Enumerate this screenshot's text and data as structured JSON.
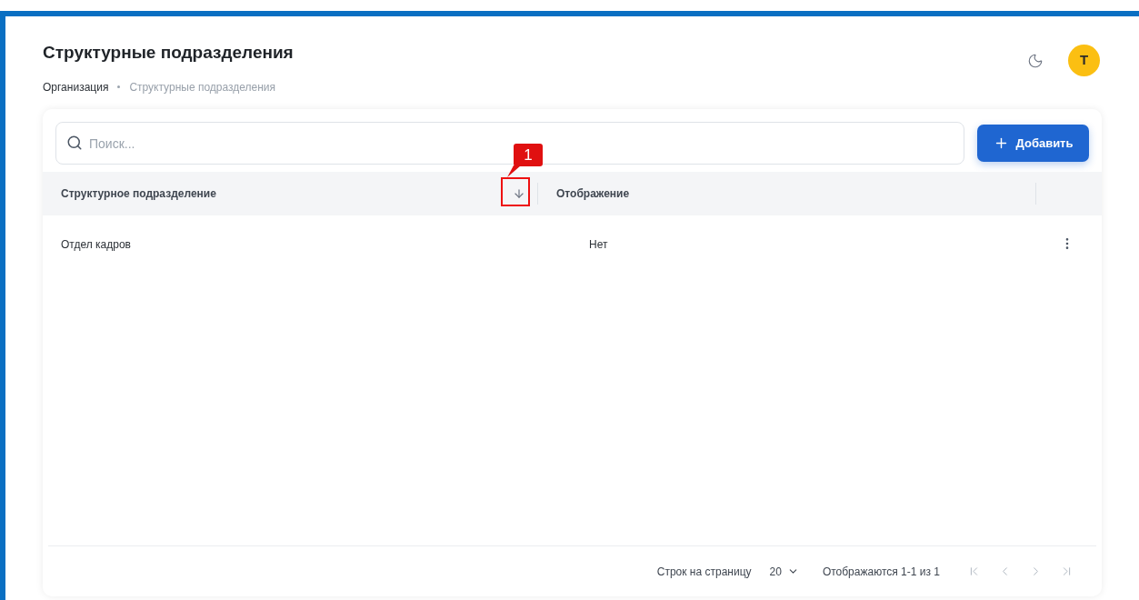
{
  "header": {
    "title": "Структурные подразделения",
    "breadcrumb": [
      {
        "label": "Организация",
        "current": false
      },
      {
        "label": "Структурные подразделения",
        "current": true
      }
    ],
    "avatar": "T"
  },
  "search": {
    "placeholder": "Поиск..."
  },
  "add_button": "Добавить",
  "table": {
    "columns": [
      {
        "label": "Структурное подразделение",
        "sorted": true,
        "descending": true
      },
      {
        "label": "Отображение"
      }
    ],
    "rows": [
      {
        "cells": [
          "Отдел кадров",
          "Нет"
        ]
      }
    ]
  },
  "annotation": {
    "label": "1"
  },
  "pagination": {
    "rows_per_page_label": "Строк на страницу",
    "rows_per_page": "20",
    "range": "Отображаются 1-1 из 1",
    "buttons": [
      {
        "kind": "first",
        "disabled": true
      },
      {
        "kind": "prev",
        "disabled": true
      },
      {
        "kind": "next",
        "disabled": true
      },
      {
        "kind": "last",
        "disabled": true
      }
    ]
  }
}
